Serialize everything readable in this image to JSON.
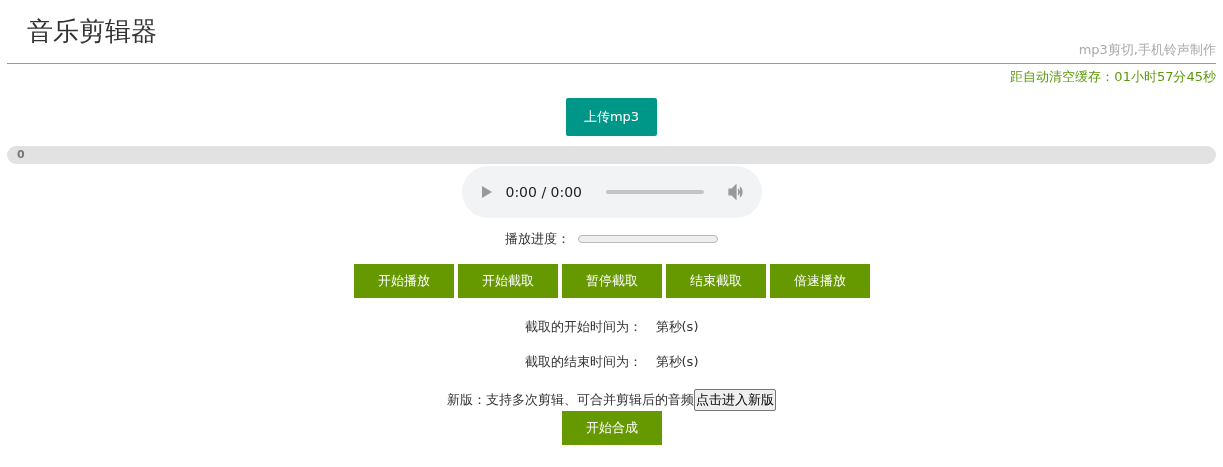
{
  "header": {
    "title": "音乐剪辑器",
    "subtitle": "mp3剪切,手机铃声制作"
  },
  "cache_timer": "距自动清空缓存：01小时57分45秒",
  "upload_button": "上传mp3",
  "upload_progress": {
    "level": 0,
    "label": "0"
  },
  "audio_player": {
    "time": "0:00 / 0:00",
    "level": 0
  },
  "playback_progress": {
    "label": "播放进度：",
    "level": 0
  },
  "controls": [
    "开始播放",
    "开始截取",
    "暂停截取",
    "结束截取",
    "倍速播放"
  ],
  "times": [
    {
      "label": "截取的开始时间为：",
      "value": "第秒(s)"
    },
    {
      "label": "截取的结束时间为：",
      "value": "第秒(s)"
    }
  ],
  "new_version": {
    "text": "新版：支持多次剪辑、可合并剪辑后的音频",
    "button": "点击进入新版"
  },
  "merge_button": "开始合成"
}
